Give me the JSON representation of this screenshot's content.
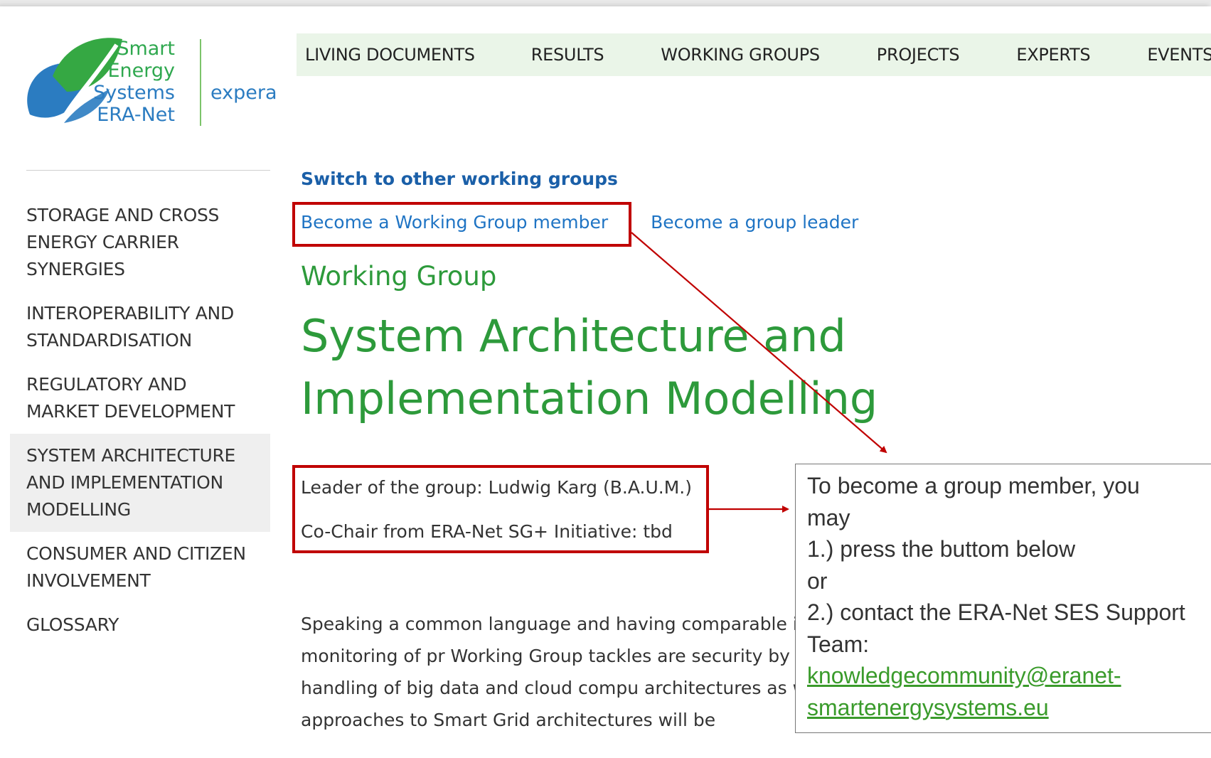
{
  "logo": {
    "name_lines": [
      "Smart",
      "Energy",
      "Systems",
      "ERA-Net"
    ],
    "partner": "expera"
  },
  "topnav": [
    "LIVING DOCUMENTS",
    "RESULTS",
    "WORKING GROUPS",
    "PROJECTS",
    "EXPERTS",
    "EVENTS"
  ],
  "sidebar": [
    {
      "label": "STORAGE AND CROSS ENERGY CARRIER SYNERGIES"
    },
    {
      "label": "INTEROPERABILITY AND STANDARDISATION"
    },
    {
      "label": "REGULATORY AND MARKET DEVELOPMENT"
    },
    {
      "label": "SYSTEM ARCHITECTURE AND IMPLEMENTATION MODELLING",
      "active": true
    },
    {
      "label": "CONSUMER AND CITIZEN INVOLVEMENT"
    },
    {
      "label": "GLOSSARY"
    }
  ],
  "main": {
    "switch_link": "Switch to other working groups",
    "member_link": "Become a Working Group member",
    "leader_link": "Become a group leader",
    "label": "Working Group",
    "title": "System Architecture and Implementation Modelling",
    "leader": "Leader of the group: Ludwig Karg (B.A.U.M.)",
    "cochair": "Co-Chair from ERA-Net SG+ Initiative: tbd",
    "description": "Speaking a common language and having comparable important for the cross-evaluation and monitoring of pr Working Group tackles are security by design and other and privacy. The handling of big data and cloud compu architectures as well. Microgrids and cellular approaches to Smart Grid architectures will be"
  },
  "callout": {
    "lines": [
      "To become a group member, you",
      "may",
      "1.) press the buttom below",
      "or",
      "2.) contact the ERA-Net SES Support",
      "Team:"
    ],
    "email_lines": [
      "knowledgecommunity@eranet-",
      "smartenergysystems.eu"
    ]
  },
  "colors": {
    "annotation_red": "#c00000",
    "heading_green": "#2d9a3b",
    "link_blue": "#1f74c4",
    "nav_bg": "#eaf5e8"
  }
}
